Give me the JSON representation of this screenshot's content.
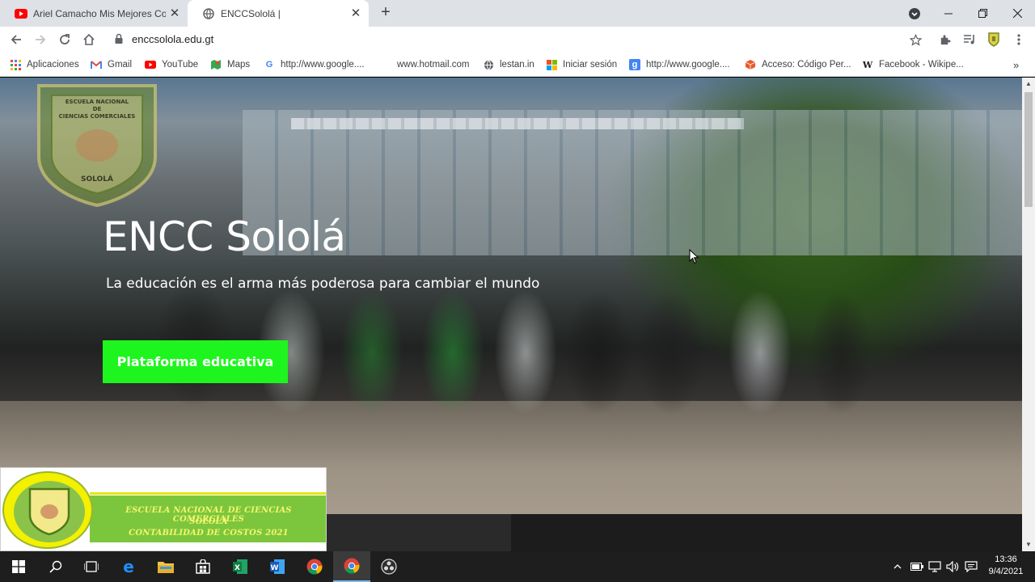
{
  "browser": {
    "tabs": [
      {
        "title": "Ariel Camacho Mis Mejores Corridos",
        "favicon": "youtube-icon",
        "active": false
      },
      {
        "title": "ENCCSololá |",
        "favicon": "globe-icon",
        "active": true
      }
    ],
    "url": "enccsolola.edu.gt",
    "bookmarks": [
      {
        "label": "Aplicaciones",
        "icon": "apps-grid-icon"
      },
      {
        "label": "Gmail",
        "icon": "gmail-icon"
      },
      {
        "label": "YouTube",
        "icon": "youtube-icon"
      },
      {
        "label": "Maps",
        "icon": "maps-icon"
      },
      {
        "label": "http://www.google....",
        "icon": "google-icon"
      },
      {
        "label": "www.hotmail.com",
        "icon": "page-icon"
      },
      {
        "label": "lestan.in",
        "icon": "globe-icon"
      },
      {
        "label": "Iniciar sesión",
        "icon": "microsoft-icon"
      },
      {
        "label": "http://www.google....",
        "icon": "google-g-blue-icon"
      },
      {
        "label": "Acceso: Código Per...",
        "icon": "cube-icon"
      },
      {
        "label": "Facebook - Wikipe...",
        "icon": "wikipedia-icon"
      }
    ]
  },
  "hero": {
    "title": "ENCC Sololá",
    "subtitle": "La educación es el arma más poderosa para cambiar el mundo",
    "cta_label": "Plataforma educativa",
    "logo_text": [
      "ESCUELA NACIONAL",
      "DE",
      "CIENCIAS COMERCIALES",
      "SOLOLÁ"
    ]
  },
  "banner": {
    "line1": "ESCUELA NACIONAL DE CIENCIAS COMERCIALES",
    "line2": "SOLOLÁ",
    "line3": "CONTABILIDAD DE COSTOS 2021"
  },
  "taskbar": {
    "time": "13:36",
    "date": "9/4/2021"
  },
  "colors": {
    "cta": "#1ef51e",
    "tabstrip": "#dee1e6",
    "taskbar": "#1e1e1e"
  }
}
